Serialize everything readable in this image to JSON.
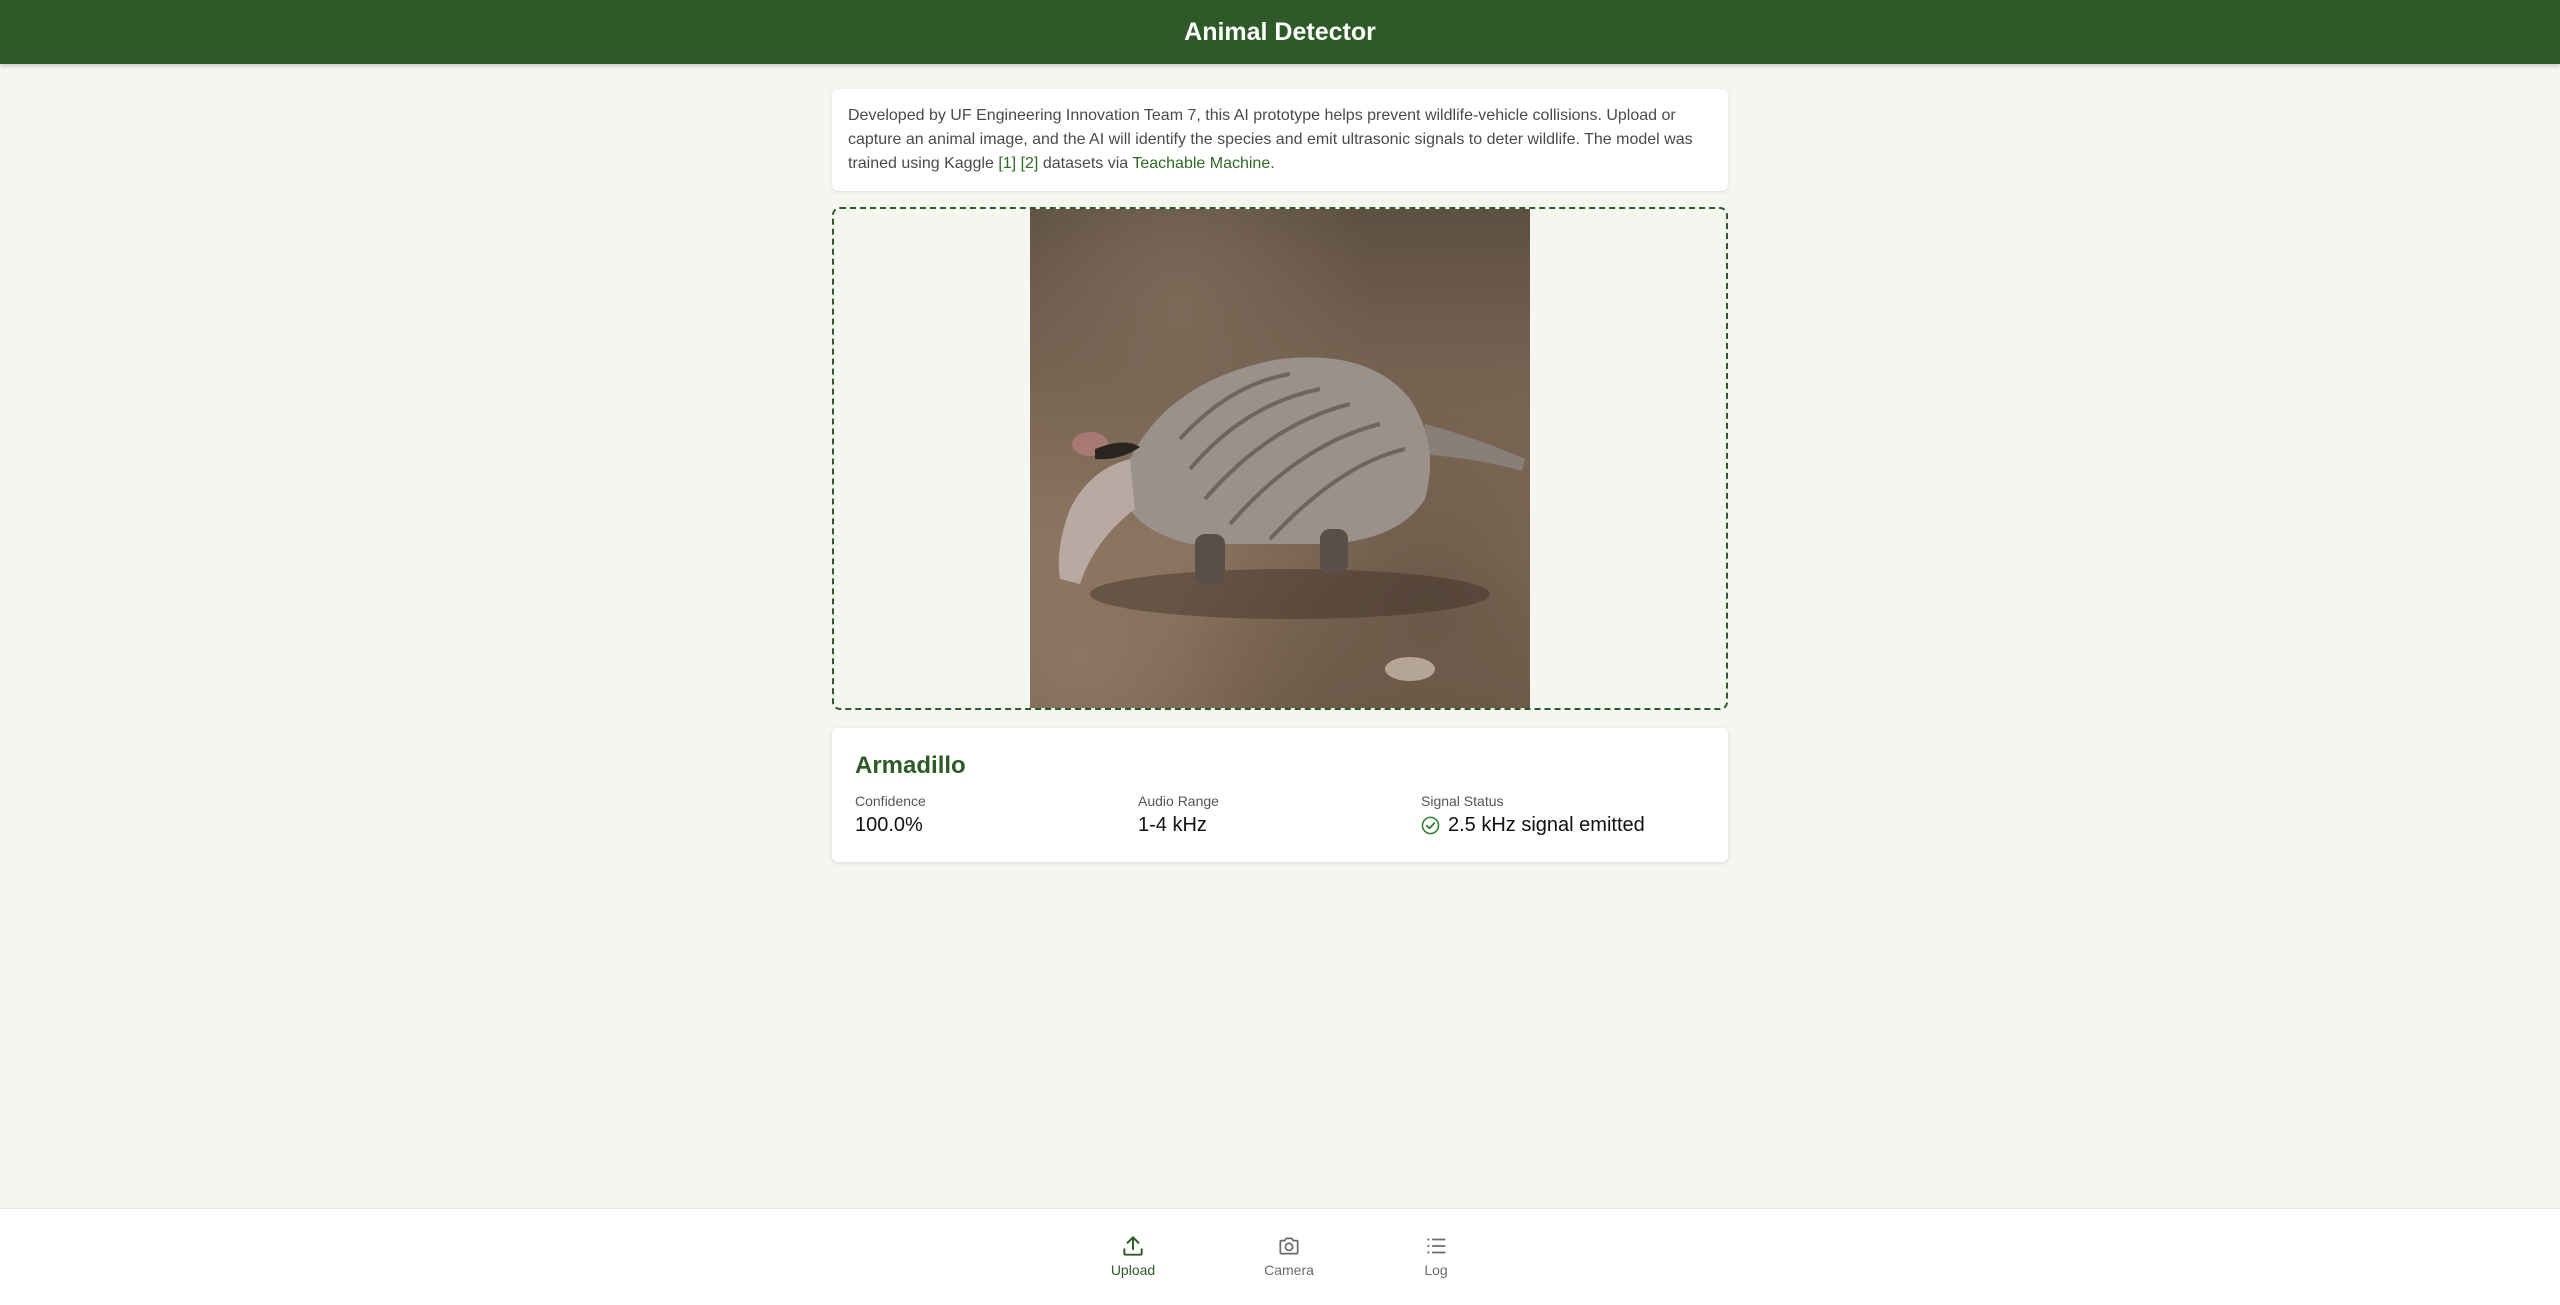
{
  "header": {
    "title": "Animal Detector"
  },
  "intro": {
    "text_before": "Developed by UF Engineering Innovation Team 7, this AI prototype helps prevent wildlife-vehicle collisions. Upload or capture an animal image, and the AI will identify the species and emit ultrasonic signals to deter wildlife. The model was trained using Kaggle ",
    "link1": "[1]",
    "link2": "[2]",
    "text_middle": " datasets via ",
    "link3": "Teachable Machine",
    "text_after": "."
  },
  "result": {
    "species": "Armadillo",
    "confidence_label": "Confidence",
    "confidence_value": "100.0%",
    "audio_label": "Audio Range",
    "audio_value": "1-4 kHz",
    "signal_label": "Signal Status",
    "signal_value": "2.5 kHz signal emitted",
    "signal_icon": "check-circle-icon"
  },
  "nav": {
    "items": [
      {
        "label": "Upload",
        "icon": "upload-icon",
        "active": true
      },
      {
        "label": "Camera",
        "icon": "camera-icon",
        "active": false
      },
      {
        "label": "Log",
        "icon": "list-icon",
        "active": false
      }
    ]
  },
  "colors": {
    "brand": "#2e5a27",
    "background": "#f4f6f0",
    "success": "#2e7d32"
  }
}
